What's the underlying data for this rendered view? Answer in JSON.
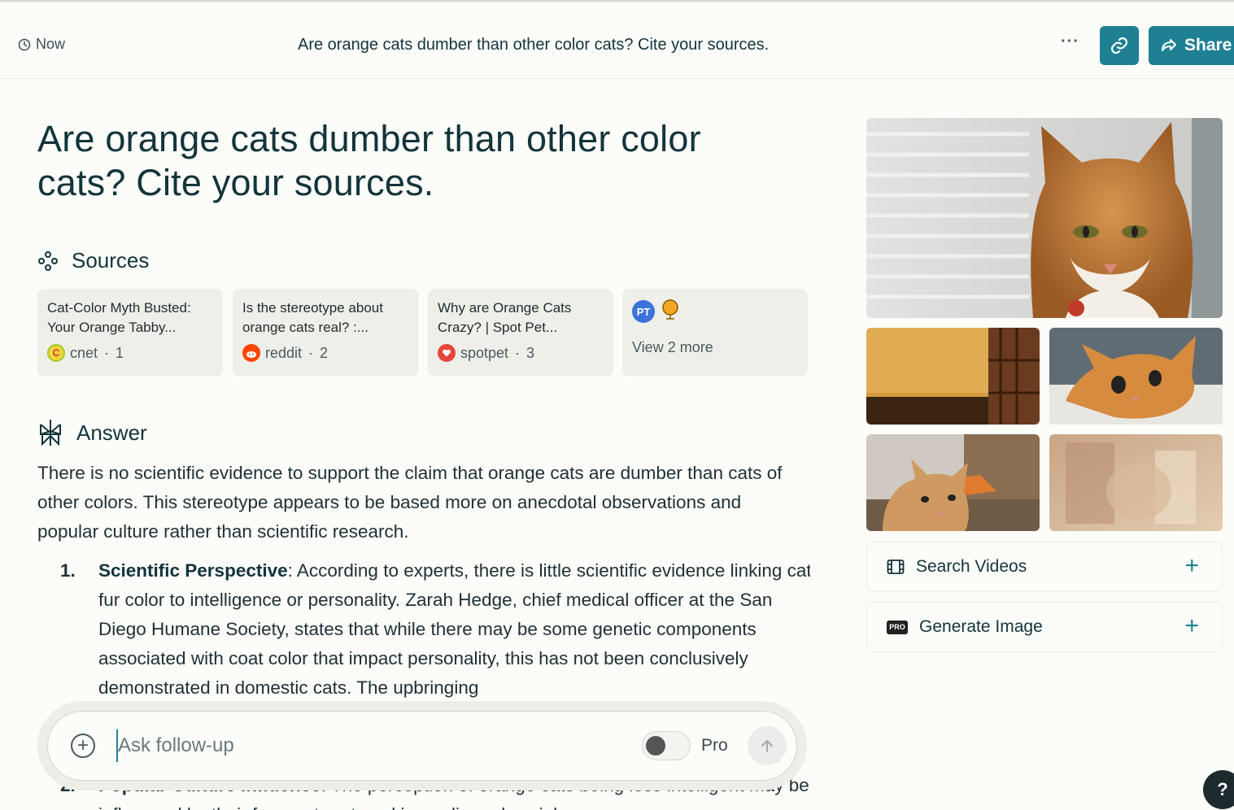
{
  "header": {
    "time_label": "Now",
    "thread_title": "Are orange cats dumber than other color cats? Cite your sources.",
    "more_label": "···",
    "share_label": "Share"
  },
  "question": "Are orange cats dumber than other color cats? Cite your sources.",
  "sources": {
    "heading": "Sources",
    "items": [
      {
        "title": "Cat-Color Myth Busted: Your Orange Tabby...",
        "site": "cnet",
        "index": "1",
        "favicon_color": "#f5d33b"
      },
      {
        "title": "Is the stereotype about orange cats real? :...",
        "site": "reddit",
        "index": "2",
        "favicon_color": "#ff4500"
      },
      {
        "title": "Why are Orange Cats Crazy? | Spot Pet...",
        "site": "spotpet",
        "index": "3",
        "favicon_color": "#e8453c"
      }
    ],
    "more": {
      "label": "View 2 more",
      "badge_text": "PT"
    }
  },
  "answer": {
    "heading": "Answer",
    "intro": "There is no scientific evidence to support the claim that orange cats are dumber than cats of other colors. This stereotype appears to be based more on anecdotal observations and popular culture rather than scientific research.",
    "points": [
      {
        "num": "1.",
        "title": "Scientific Perspective",
        "text": ": According to experts, there is little scientific evidence linking cat fur color to intelligence or personality. Zarah Hedge, chief medical officer at the San Diego Humane Society, states that while there may be some genetic components associated with coat color that impact personality, this has not been conclusively demonstrated in domestic cats. The upbringing"
      },
      {
        "num": "2.",
        "title": "Popular Culture Influence",
        "text": ": The perception of orange cats being less intelligent may be influenced by their frequent portrayal in media and social"
      }
    ]
  },
  "followup": {
    "placeholder": "Ask follow-up",
    "pro_label": "Pro",
    "pro_enabled": false
  },
  "sidebar": {
    "search_videos_label": "Search Videos",
    "generate_image_label": "Generate Image",
    "pro_badge": "PRO"
  },
  "help_label": "?",
  "colors": {
    "accent": "#1f8094",
    "background": "#fcfcf9",
    "text": "#13343b"
  }
}
